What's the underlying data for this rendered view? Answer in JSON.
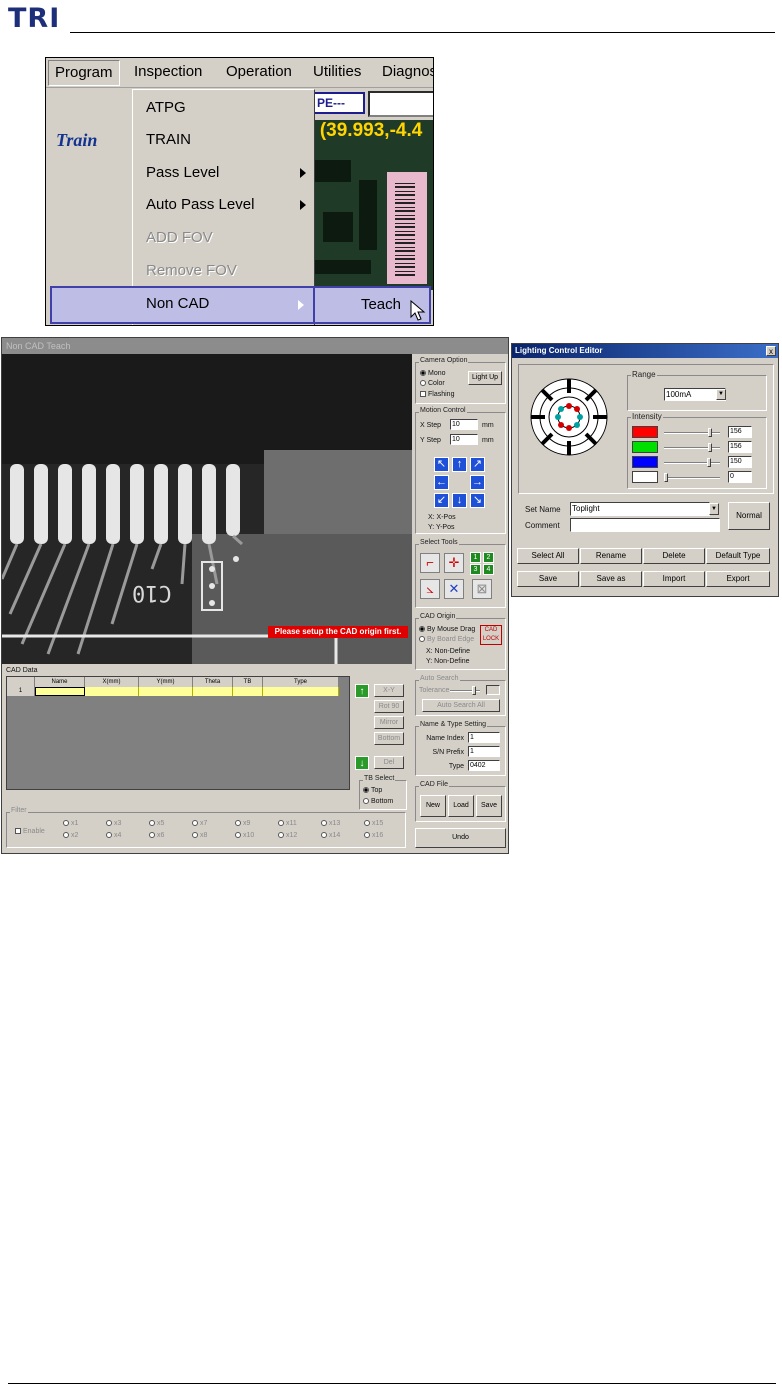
{
  "page": {
    "logo": "TRI"
  },
  "menu": {
    "bar": [
      "Program",
      "Inspection",
      "Operation",
      "Utilities",
      "Diagnos"
    ],
    "mode_label": "Train",
    "mode_field": "PE---",
    "coordinate_readout": "4 (39.993,-4.4",
    "items": [
      {
        "label": "ATPG",
        "enabled": true,
        "submenu": false
      },
      {
        "label": "TRAIN",
        "enabled": true,
        "submenu": false
      },
      {
        "label": "Pass Level",
        "enabled": true,
        "submenu": true
      },
      {
        "label": "Auto Pass Level",
        "enabled": true,
        "submenu": true
      },
      {
        "label": "ADD FOV",
        "enabled": false,
        "submenu": false
      },
      {
        "label": "Remove FOV",
        "enabled": false,
        "submenu": false
      },
      {
        "label": "Non CAD",
        "enabled": true,
        "submenu": true
      }
    ],
    "submenu_item": "Teach",
    "highlight_color": "#bdbde6"
  },
  "noncad": {
    "title": "Non CAD Teach",
    "warning": "Please setup the CAD origin first.",
    "silkscreen": "C10",
    "camera_option": {
      "title": "Camera Option",
      "mono": "Mono",
      "color": "Color",
      "flashing": "Flashing",
      "light_up": "Light Up"
    },
    "motion_control": {
      "title": "Motion Control",
      "x_step_label": "X Step",
      "x_step": "10",
      "y_step_label": "Y Step",
      "y_step": "10",
      "unit": "mm",
      "x_pos": "X: X-Pos",
      "y_pos": "Y: Y-Pos"
    },
    "select_tools": {
      "title": "Select Tools",
      "numbers": [
        "1",
        "2",
        "3",
        "4"
      ]
    },
    "cad_origin": {
      "title": "CAD Origin",
      "by_mouse_drag": "By Mouse Drag",
      "by_board_edge": "By Board Edge",
      "cad_lock": "CAD LOCK",
      "x_status": "X: Non-Define",
      "y_status": "Y: Non-Define"
    },
    "auto_search": {
      "title": "Auto Search",
      "tolerance": "Tolerance",
      "button": "Auto Search All"
    },
    "name_type": {
      "title": "Name & Type Setting",
      "name_index_label": "Name Index",
      "name_index": "1",
      "sn_prefix_label": "S/N Prefix",
      "sn_prefix": "1",
      "type_label": "Type",
      "type": "0402"
    },
    "cad_file": {
      "title": "CAD File",
      "new": "New",
      "load": "Load",
      "save": "Save"
    },
    "undo": "Undo",
    "cad_data": {
      "title": "CAD Data",
      "columns": [
        "",
        "Name",
        "X(mm)",
        "Y(mm)",
        "Theta",
        "TB",
        "Type"
      ],
      "row_index": "1",
      "side_buttons": [
        "X-Y",
        "Rot 90",
        "Mirror",
        "Bottom",
        "Del"
      ]
    },
    "tb_select": {
      "title": "TB Select",
      "top": "Top",
      "bottom": "Bottom"
    },
    "filter": {
      "title": "Filter",
      "enable": "Enable",
      "options": [
        "x1",
        "x2",
        "x3",
        "x4",
        "x5",
        "x6",
        "x7",
        "x8",
        "x9",
        "x10",
        "x11",
        "x12",
        "x13",
        "x14",
        "x15",
        "x16"
      ]
    }
  },
  "lighting": {
    "title": "Lighting Control Editor",
    "close": "x",
    "range_title": "Range",
    "range_value": "100mA",
    "intensity_title": "Intensity",
    "channels": [
      {
        "color": "#ff0000",
        "value": "156",
        "level": 0.85
      },
      {
        "color": "#00e000",
        "value": "156",
        "level": 0.85
      },
      {
        "color": "#0000ff",
        "value": "150",
        "level": 0.82
      },
      {
        "color": "#ffffff",
        "value": "0",
        "level": 0.0
      }
    ],
    "set_name_label": "Set Name",
    "set_name": "Toplight",
    "comment_label": "Comment",
    "comment": "",
    "normal": "Normal",
    "buttons": [
      "Select All",
      "Rename",
      "Delete",
      "Default Type",
      "Save",
      "Save as",
      "Import",
      "Export"
    ]
  }
}
